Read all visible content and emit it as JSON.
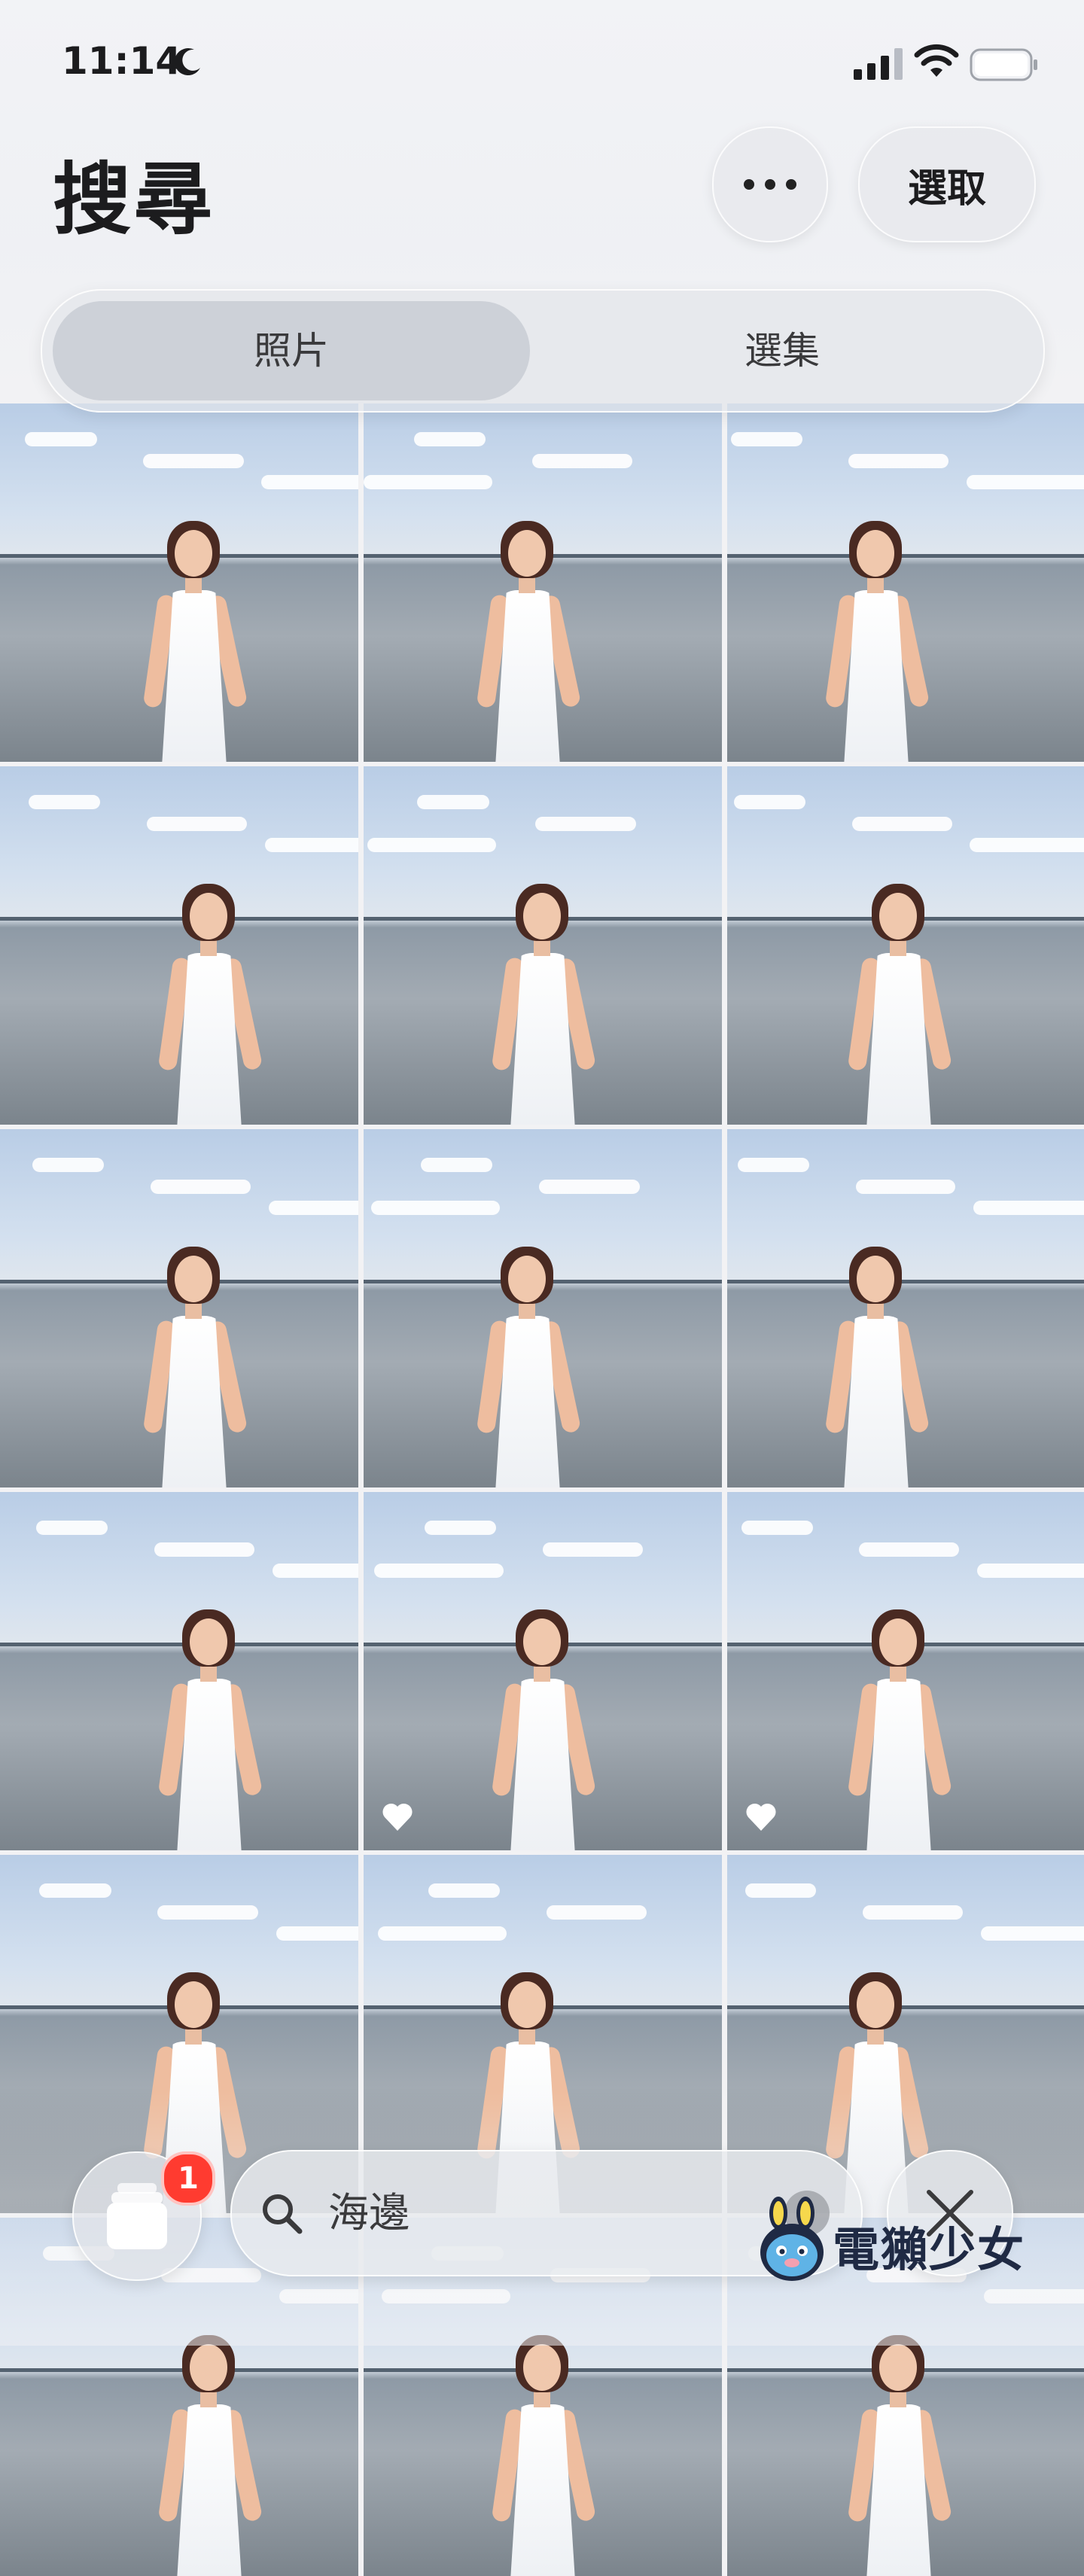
{
  "status_bar": {
    "time": "11:14"
  },
  "header": {
    "title": "搜尋",
    "more_icon": "ellipsis-icon",
    "select_label": "選取",
    "segments": [
      {
        "label": "照片",
        "active": true
      },
      {
        "label": "選集",
        "active": false
      }
    ]
  },
  "grid": {
    "rows": 6,
    "columns": 3,
    "favorites_visible": [
      11,
      12
    ]
  },
  "bottom_bar": {
    "stack_badge": "1",
    "search_value": "海邊",
    "search_icon": "magnifier-icon",
    "clear_icon": "clear-circle-icon",
    "close_icon": "close-x-icon"
  },
  "watermark": {
    "text": "電獺少女"
  },
  "colors": {
    "badge": "#ff3b30",
    "text": "#1c1c1e"
  }
}
